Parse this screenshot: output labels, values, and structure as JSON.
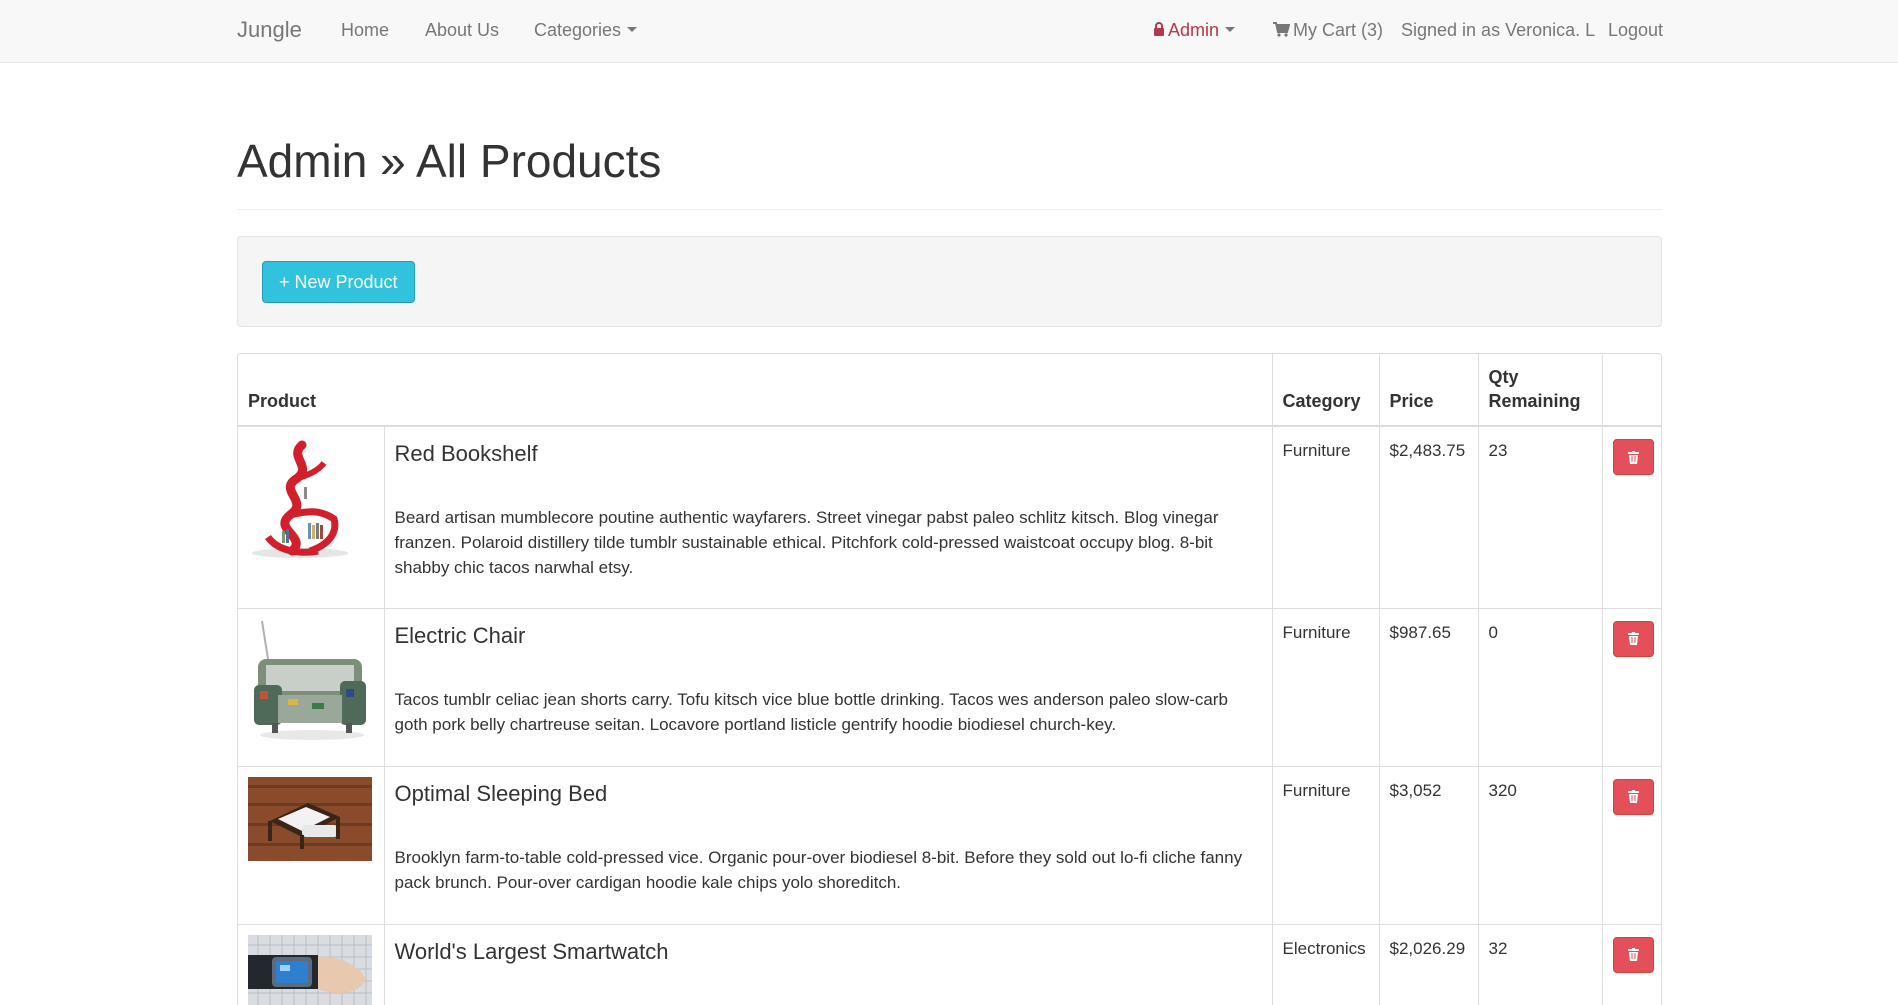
{
  "navbar": {
    "brand": "Jungle",
    "home": "Home",
    "about": "About Us",
    "categories": "Categories",
    "admin": "Admin",
    "cart": "My Cart (3)",
    "signed_in": "Signed in as Veronica. L",
    "logout": "Logout"
  },
  "page": {
    "title": "Admin » All Products",
    "new_product_label": "+ New Product"
  },
  "table": {
    "headers": {
      "product": "Product",
      "category": "Category",
      "price": "Price",
      "qty": "Qty Remaining"
    },
    "rows": [
      {
        "name": "Red Bookshelf",
        "description": "Beard artisan mumblecore poutine authentic wayfarers. Street vinegar pabst paleo schlitz kitsch. Blog vinegar franzen. Polaroid distillery tilde tumblr sustainable ethical. Pitchfork cold-pressed waistcoat occupy blog. 8-bit shabby chic tacos narwhal etsy.",
        "category": "Furniture",
        "price": "$2,483.75",
        "qty": "23"
      },
      {
        "name": "Electric Chair",
        "description": "Tacos tumblr celiac jean shorts carry. Tofu kitsch vice blue bottle drinking. Tacos wes anderson paleo slow-carb goth pork belly chartreuse seitan. Locavore portland listicle gentrify hoodie biodiesel church-key.",
        "category": "Furniture",
        "price": "$987.65",
        "qty": "0"
      },
      {
        "name": "Optimal Sleeping Bed",
        "description": "Brooklyn farm-to-table cold-pressed vice. Organic pour-over biodiesel 8-bit. Before they sold out lo-fi cliche fanny pack brunch. Pour-over cardigan hoodie kale chips yolo shoreditch.",
        "category": "Furniture",
        "price": "$3,052",
        "qty": "320"
      },
      {
        "name": "World's Largest Smartwatch",
        "description": "",
        "category": "Electronics",
        "price": "$2,026.29",
        "qty": "32"
      }
    ]
  },
  "colors": {
    "accent": "#31c3dd",
    "danger": "#e4505a",
    "admin_link": "#b4374a"
  },
  "icons": {
    "admin": "lock-icon",
    "cart": "cart-icon",
    "delete": "trash-icon",
    "dropdown": "caret-down-icon"
  }
}
